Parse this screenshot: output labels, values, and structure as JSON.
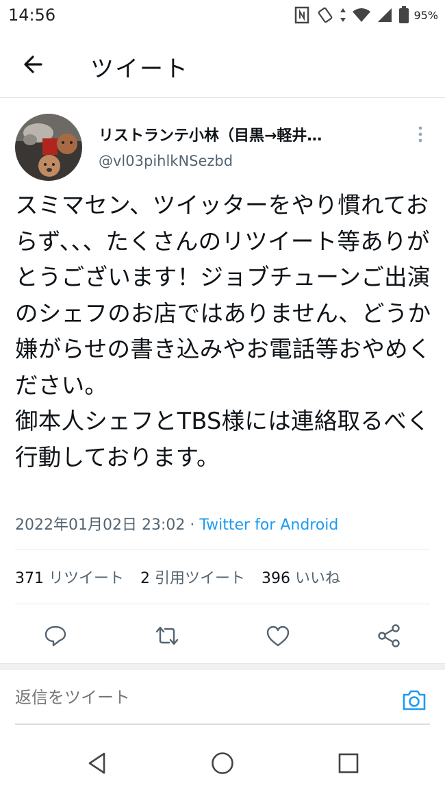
{
  "status_bar": {
    "time": "14:56",
    "battery": "95%",
    "icons": [
      "nfc-icon",
      "rotate-icon",
      "data-arrows-icon",
      "wifi-icon",
      "cell-signal-icon",
      "battery-icon"
    ]
  },
  "header": {
    "title": "ツイート",
    "back_icon": "arrow-left-icon"
  },
  "tweet": {
    "display_name": "リストランテ小林（目黒→軽井…",
    "handle": "@vl03pihlkNSezbd",
    "body": "スミマセン、ツイッターをやり慣れておらず、、、たくさんのリツイート等ありがとうございます！ジョブチューンご出演のシェフのお店ではありません、どうか嫌がらせの書き込みやお電話等おやめください。\n御本人シェフとTBS様には連絡取るべく行動しております。",
    "timestamp": "2022年01月02日 23:02",
    "separator": " · ",
    "source": "Twitter for Android"
  },
  "stats": {
    "retweets_count": "371",
    "retweets_label": "リツイート",
    "quotes_count": "2",
    "quotes_label": "引用ツイート",
    "likes_count": "396",
    "likes_label": "いいね"
  },
  "actions": [
    "reply-icon",
    "retweet-icon",
    "like-icon",
    "share-icon"
  ],
  "reply": {
    "placeholder": "返信をツイート"
  },
  "colors": {
    "accent": "#1d9bf0",
    "secondary_text": "#536471",
    "primary_text": "#0f1419"
  }
}
